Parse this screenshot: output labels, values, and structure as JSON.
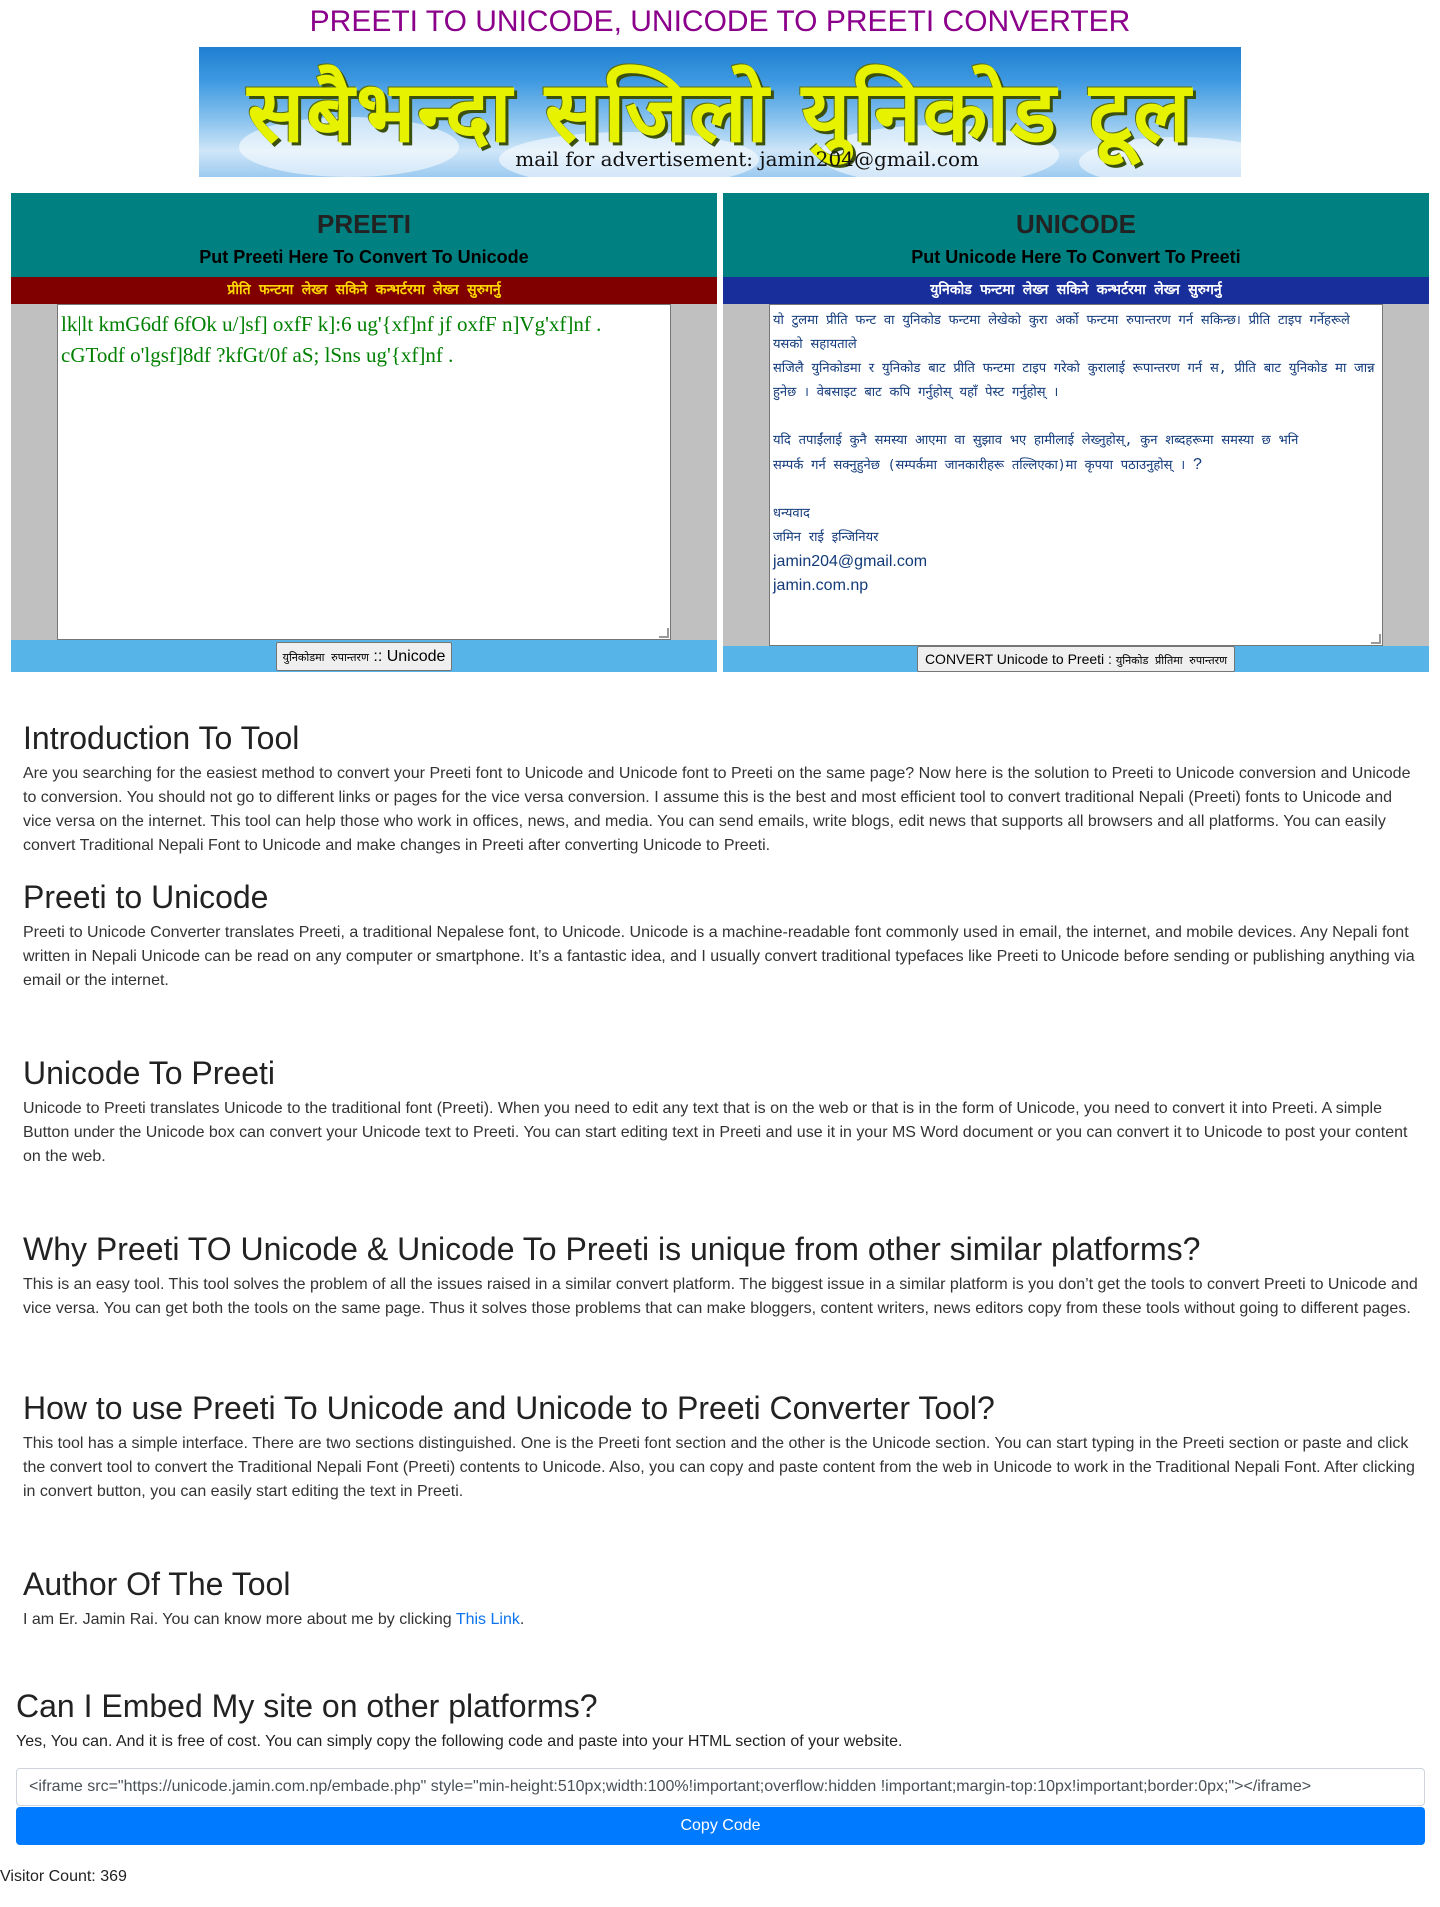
{
  "header": {
    "title": "PREETI TO UNICODE, UNICODE TO PREETI CONVERTER"
  },
  "banner": {
    "headline": "सबैभन्दा सजिलो युनिकोड टूल",
    "mail_text": "mail for advertisement: jamin204@gmail.com"
  },
  "preeti_panel": {
    "title": "PREETI",
    "subtitle": "Put Preeti Here To Convert To Unicode",
    "strip_text": "प्रीति फन्टमा लेख्न सकिने कन्भर्टरमा लेख्न सुरुगर्नु",
    "editor_text": "lk|lt kmG6df 6fOk u/]sf] oxfF k]:6 ug'{xf]nf jf oxfF n]Vg'xf]nf . cGTodf o'lgsf]8df ?kfGt/0f aS; lSns ug'{xf]nf .",
    "button_label_dev": "युनिकोडमा रुपान्तरण",
    "button_label_en": ":: Unicode"
  },
  "unicode_panel": {
    "title": "UNICODE",
    "subtitle": "Put Unicode Here To Convert To Preeti",
    "strip_text": "युनिकोड फन्टमा लेख्न सकिने कन्भर्टरमा लेख्न सुरुगर्नु",
    "editor_lines": [
      "यो टुलमा प्रीति फन्ट वा युनिकोड फन्टमा लेखेको कुरा अर्को फन्टमा रुपान्तरण गर्न सकिन्छ। प्रीति टाइप गर्नेहरूले यसको सहायताले",
      "सजिलै युनिकोडमा र युनिकोड बाट प्रीति फन्टमा टाइप गरेको कुरालाई रूपान्तरण गर्न स, प्रीति बाट युनिकोड मा जान्न",
      "हुनेछ । वेबसाइट बाट कपि गर्नुहोस् यहाँ पेस्ट गर्नुहोस् ।",
      "",
      "यदि तपाईंलाई कुनै समस्या आएमा वा सुझाव भए हामीलाई लेख्नुहोस्, कुन शब्दहरूमा समस्या छ भनि",
      "सम्पर्क गर्न सक्नुहुनेछ (सम्पर्कमा जानकारीहरू तल्लिएका)मा कृपया पठाउनुहोस् ।",
      "",
      "धन्यवाद",
      "जमिन राई इन्जिनियर",
      "jamin204@gmail.com",
      "jamin.com.np"
    ],
    "editor_line_q": "?",
    "button_label_en": "CONVERT Unicode to Preeti :",
    "button_label_dev": "युनिकोड प्रीतिमा रुपान्तरण"
  },
  "sections": [
    {
      "heading": "Introduction To Tool",
      "body": "Are you searching for the easiest method to convert your Preeti font to Unicode and Unicode font to Preeti on the same page? Now here is the solution to Preeti to Unicode conversion and Unicode to conversion. You should not go to different links or pages for the vice versa conversion. I assume this is the best and most efficient tool to convert traditional Nepali (Preeti) fonts to Unicode and vice versa on the internet.  This tool can help those who work in offices, news, and media. You can send emails, write blogs, edit news that supports all browsers and all platforms. You can easily convert Traditional Nepali Font to Unicode and make changes in Preeti after converting Unicode to Preeti."
    },
    {
      "heading": "Preeti to Unicode",
      "body": "Preeti to Unicode Converter translates Preeti, a traditional Nepalese font, to Unicode. Unicode is a machine-readable font commonly used in email, the internet, and mobile devices. Any Nepali font written in Nepali Unicode can be read on any computer or smartphone. It’s a fantastic idea, and I usually convert traditional typefaces like Preeti to Unicode before sending or publishing anything via email or the internet."
    },
    {
      "heading": "Unicode To Preeti",
      "body": "Unicode to Preeti translates Unicode to the traditional font (Preeti).  When you need to edit any text that is on the web or that is in the form of Unicode, you need to convert it into Preeti. A simple Button under the Unicode box can convert your Unicode text to Preeti. You can start editing text in Preeti and use it in your MS Word document or you can convert it to Unicode to post your content on the web."
    },
    {
      "heading": "Why Preeti TO Unicode & Unicode To Preeti is unique from other similar platforms?",
      "body": "This is an easy tool. This tool solves the problem of all the issues raised in a similar convert platform. The biggest issue in a similar platform is you don’t get the tools to convert Preeti to Unicode and vice versa. You can get both the tools on the same page. Thus it solves those problems that can make bloggers, content writers, news editors copy from these tools without going to different pages."
    },
    {
      "heading": "How to use Preeti To Unicode and Unicode to Preeti Converter Tool?",
      "body": "This tool has a simple interface. There are two sections distinguished. One is the Preeti font section and the other is the Unicode section. You can start typing in the Preeti section or paste and click the convert tool to convert the Traditional Nepali Font (Preeti) contents to Unicode. Also, you can copy and paste content from the web in Unicode to work in the Traditional Nepali Font. After clicking in convert button, you can easily start editing the text in Preeti."
    }
  ],
  "author": {
    "heading": "Author Of The Tool",
    "body_prefix": "I am Er. Jamin Rai. You can know more about me by clicking ",
    "link_text": "This Link",
    "body_suffix": "."
  },
  "embed": {
    "heading": "Can I Embed My site on other platforms?",
    "body": "Yes, You can. And it is free of cost. You can simply copy the following code and paste into your HTML section of your website.",
    "code": "<iframe src=\"https://unicode.jamin.com.np/embade.php\" style=\"min-height:510px;width:100%!important;overflow:hidden !important;margin-top:10px!important;border:0px;\"></iframe>",
    "copy_label": "Copy Code"
  },
  "footer": {
    "visitor_count": "Visitor Count: 369"
  },
  "colors": {
    "title": "#8b008b",
    "panel_head": "#008080",
    "strip_red": "#800000",
    "strip_blue": "#172e9b",
    "button_bar": "#56b4e9",
    "preeti_text": "#008000",
    "copy_button": "#007bff"
  }
}
